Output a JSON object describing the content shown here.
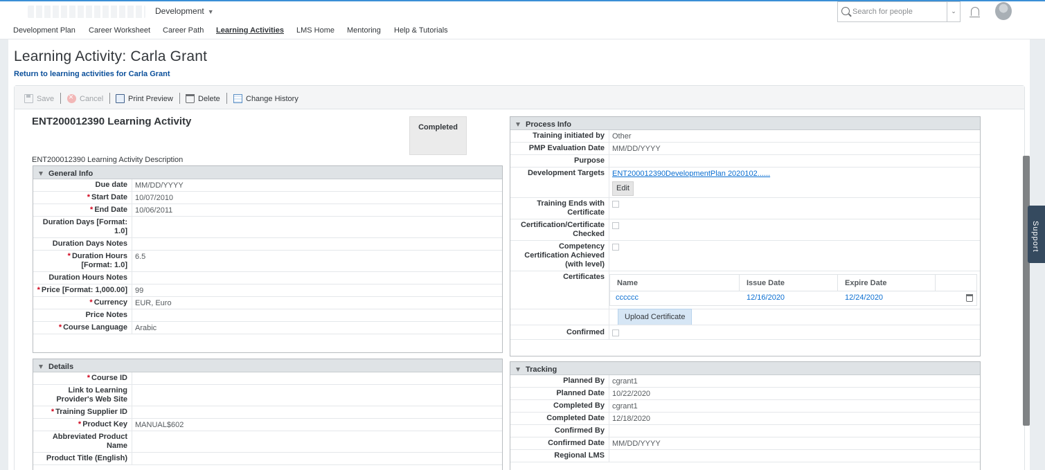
{
  "header": {
    "logo": "SAP SuccessFactors",
    "module": "Development",
    "search_placeholder": "Search for people"
  },
  "nav": [
    "Development Plan",
    "Career Worksheet",
    "Career Path",
    "Learning Activities",
    "LMS Home",
    "Mentoring",
    "Help & Tutorials"
  ],
  "page": {
    "title": "Learning Activity: Carla Grant",
    "back_link": "Return to learning activities for Carla Grant"
  },
  "toolbar": {
    "save": "Save",
    "cancel": "Cancel",
    "print_preview": "Print Preview",
    "delete": "Delete",
    "change_history": "Change History"
  },
  "support_label": "Support",
  "activity": {
    "title": "ENT200012390 Learning Activity",
    "status": "Completed",
    "description": "ENT200012390 Learning Activity Description"
  },
  "general_info": {
    "heading": "General Info",
    "rows": [
      {
        "label": "Due date",
        "value": "MM/DD/YYYY",
        "required": false
      },
      {
        "label": "Start Date",
        "value": "10/07/2010",
        "required": true
      },
      {
        "label": "End Date",
        "value": "10/06/2011",
        "required": true
      },
      {
        "label": "Duration Days [Format: 1.0]",
        "value": "",
        "required": false
      },
      {
        "label": "Duration Days Notes",
        "value": "",
        "required": false
      },
      {
        "label": "Duration Hours [Format: 1.0]",
        "value": "6.5",
        "required": true
      },
      {
        "label": "Duration Hours Notes",
        "value": "",
        "required": false
      },
      {
        "label": "Price [Format: 1,000.00]",
        "value": "99",
        "required": true
      },
      {
        "label": "Currency",
        "value": "EUR, Euro",
        "required": true
      },
      {
        "label": "Price Notes",
        "value": "",
        "required": false
      },
      {
        "label": "Course Language",
        "value": "Arabic",
        "required": true
      }
    ]
  },
  "details": {
    "heading": "Details",
    "rows": [
      {
        "label": "Course ID",
        "value": "",
        "required": true
      },
      {
        "label": "Link to Learning Provider's Web Site",
        "value": "",
        "required": false
      },
      {
        "label": "Training Supplier ID",
        "value": "",
        "required": true
      },
      {
        "label": "Product Key",
        "value": "MANUAL$602",
        "required": true
      },
      {
        "label": "Abbreviated Product Name",
        "value": "",
        "required": false
      },
      {
        "label": "Product Title (English)",
        "value": "",
        "required": false
      }
    ]
  },
  "process_info": {
    "heading": "Process Info",
    "training_initiated_by": {
      "label": "Training initiated by",
      "value": "Other"
    },
    "pmp_evaluation_date": {
      "label": "PMP Evaluation Date",
      "value": "MM/DD/YYYY"
    },
    "purpose": {
      "label": "Purpose",
      "value": ""
    },
    "development_targets": {
      "label": "Development Targets",
      "value": "ENT200012390DevelopmentPlan 2020102......",
      "edit": "Edit"
    },
    "training_ends_with_certificate": {
      "label": "Training Ends with Certificate"
    },
    "certification_checked": {
      "label": "Certification/Certificate Checked"
    },
    "competency_certification": {
      "label": "Competency Certification Achieved (with level)"
    },
    "certificates": {
      "label": "Certificates",
      "columns": [
        "Name",
        "Issue Date",
        "Expire Date"
      ],
      "rows": [
        {
          "name": "cccccc",
          "issue": "12/16/2020",
          "expire": "12/24/2020"
        }
      ],
      "upload": "Upload Certificate"
    },
    "confirmed": {
      "label": "Confirmed"
    }
  },
  "tracking": {
    "heading": "Tracking",
    "rows": [
      {
        "label": "Planned By",
        "value": "cgrant1"
      },
      {
        "label": "Planned Date",
        "value": "10/22/2020"
      },
      {
        "label": "Completed By",
        "value": "cgrant1"
      },
      {
        "label": "Completed Date",
        "value": "12/18/2020"
      },
      {
        "label": "Confirmed By",
        "value": ""
      },
      {
        "label": "Confirmed Date",
        "value": "MM/DD/YYYY"
      },
      {
        "label": "Regional LMS",
        "value": ""
      }
    ]
  }
}
